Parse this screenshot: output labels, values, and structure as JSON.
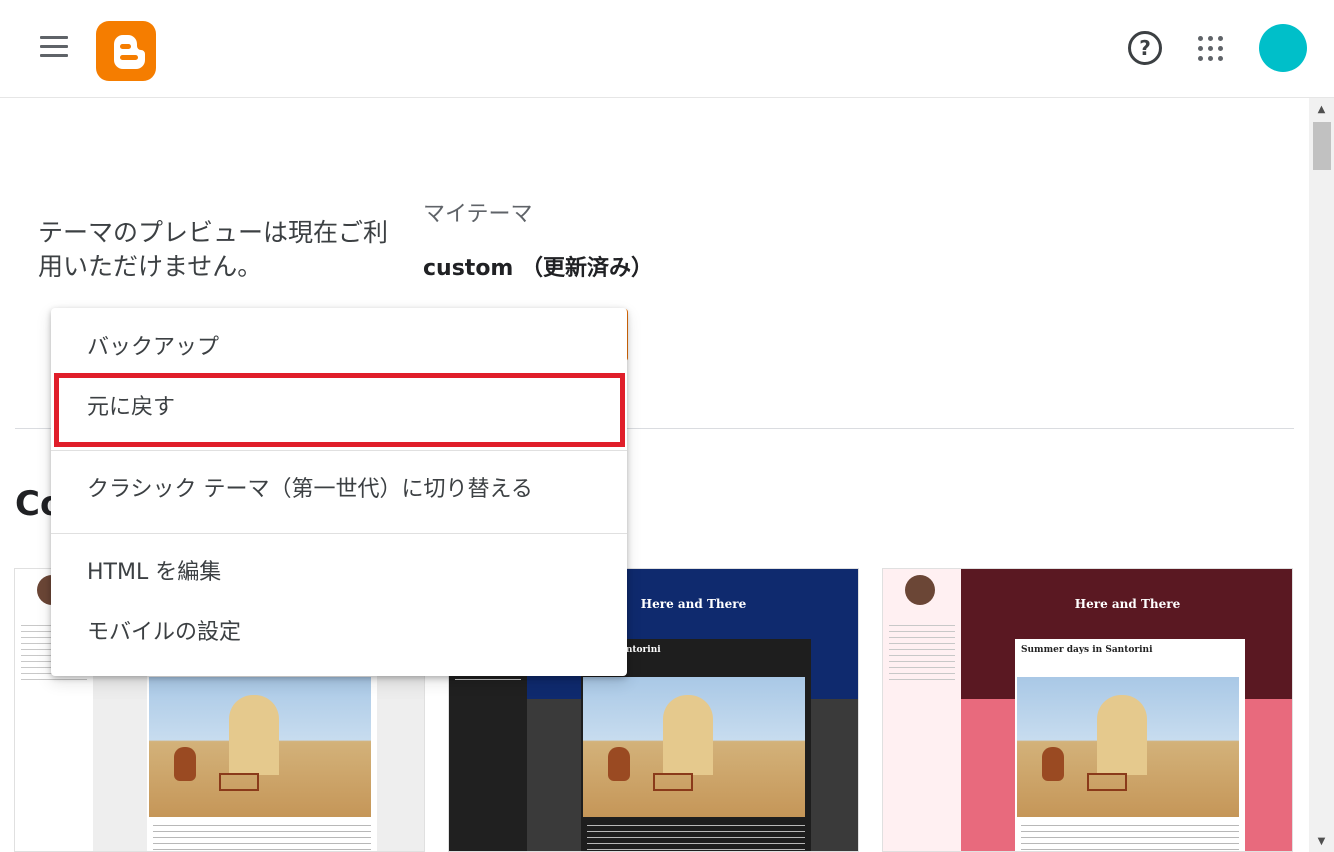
{
  "header": {
    "menu_icon": "hamburger-menu-icon",
    "logo_icon": "blogger-logo-icon",
    "help_icon": "help-circle-icon",
    "apps_icon": "apps-grid-icon",
    "avatar_color": "#00bfc9",
    "logo_color": "#f57d00"
  },
  "main": {
    "preview_unavailable": "テーマのプレビューは現在ご利用いただけません。",
    "my_theme_label": "マイテーマ",
    "theme_name": "custom （更新済み）",
    "section_heading": "Co"
  },
  "dropdown": {
    "items": [
      {
        "label": "バックアップ"
      },
      {
        "label": "元に戻す"
      },
      {
        "label": "クラシック テーマ（第一世代）に切り替える"
      },
      {
        "label": "HTML を編集"
      },
      {
        "label": "モバイルの設定"
      }
    ],
    "highlight_color": "#e01e2a"
  },
  "cards": [
    {
      "blog_title": "",
      "post_title": ""
    },
    {
      "blog_title": "Here and There",
      "post_title": "ys in Santorini"
    },
    {
      "blog_title": "Here and There",
      "post_title": "Summer days in Santorini"
    }
  ]
}
